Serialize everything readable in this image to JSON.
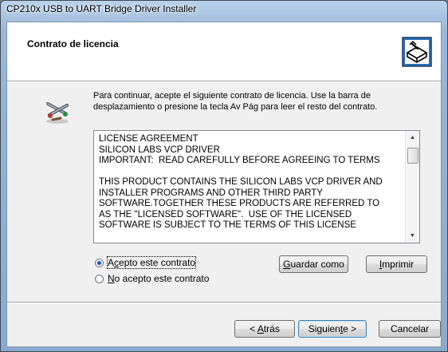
{
  "window": {
    "title": "CP210x USB to UART Bridge Driver Installer"
  },
  "header": {
    "title": "Contrato de licencia"
  },
  "instructions": "Para continuar, acepte el siguiente contrato de licencia. Use la barra de desplazamiento o presione la tecla Av Pág para leer el resto del contrato.",
  "license": {
    "lines": [
      "LICENSE AGREEMENT",
      "SILICON LABS VCP DRIVER",
      "IMPORTANT:  READ CAREFULLY BEFORE AGREEING TO TERMS",
      "",
      "THIS PRODUCT CONTAINS THE SILICON LABS VCP DRIVER AND",
      "INSTALLER PROGRAMS AND OTHER THIRD PARTY",
      "SOFTWARE.TOGETHER THESE PRODUCTS ARE REFERRED TO",
      "AS THE \"LICENSED SOFTWARE\".  USE OF THE LICENSED",
      "SOFTWARE IS SUBJECT TO THE TERMS OF THIS LICENSE"
    ]
  },
  "options": {
    "accept_label": "Acepto este contrato",
    "decline_label": "No acepto este contrato",
    "selected": "accept"
  },
  "buttons": {
    "save": "Guardar como",
    "print": "Imprimir",
    "back": "< Atrás",
    "next": "Siguiente >",
    "cancel": "Cancelar"
  },
  "icons": {
    "header_logo": "usb-installer-icon",
    "wizard": "wizard-tools-icon"
  }
}
